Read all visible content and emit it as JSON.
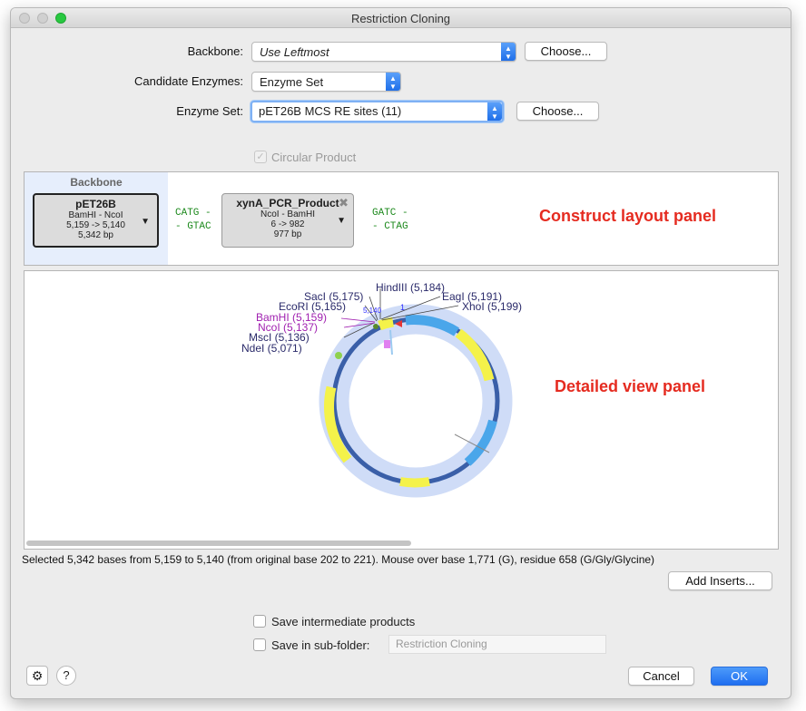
{
  "window": {
    "title": "Restriction Cloning"
  },
  "form": {
    "backbone_label": "Backbone:",
    "backbone_value": "Use Leftmost",
    "choose_label": "Choose...",
    "candidate_label": "Candidate Enzymes:",
    "candidate_value": "Enzyme Set",
    "enzyme_set_label": "Enzyme Set:",
    "enzyme_set_value": "pET26B MCS RE sites (11)",
    "circular_label": "Circular Product"
  },
  "construct": {
    "backbone_header": "Backbone",
    "backbone_fragment": {
      "name": "pET26B",
      "enzymes": "BamHI - NcoI",
      "range": "5,159 -> 5,140",
      "length": "5,342 bp"
    },
    "insert_fragment": {
      "name": "xynA_PCR_Product",
      "enzymes": "NcoI - BamHI",
      "range": "6 -> 982",
      "length": "977 bp"
    },
    "left_overhang": [
      "CATG -",
      "- GTAC"
    ],
    "right_overhang": [
      "GATC -",
      "- CTAG"
    ],
    "annotation": "Construct layout panel"
  },
  "detail": {
    "annotation": "Detailed view panel",
    "sites": [
      {
        "label": "HindIII (5,184)",
        "color": "#2a2a6a"
      },
      {
        "label": "EagI (5,191)",
        "color": "#2a2a6a"
      },
      {
        "label": "XhoI (5,199)",
        "color": "#2a2a6a"
      },
      {
        "label": "SacI (5,175)",
        "color": "#2a2a6a"
      },
      {
        "label": "EcoRI (5,165)",
        "color": "#2a2a6a"
      },
      {
        "label": "BamHI (5,159)",
        "color": "#a020b0"
      },
      {
        "label": "NcoI (5,137)",
        "color": "#a020b0"
      },
      {
        "label": "MscI (5,136)",
        "color": "#2a2a6a"
      },
      {
        "label": "NdeI (5,071)",
        "color": "#2a2a6a"
      }
    ],
    "small_labels": {
      "left": "5,140",
      "right": "1"
    }
  },
  "status": "Selected 5,342 bases from 5,159 to 5,140 (from original base 202 to 221). Mouse over base 1,771 (G), residue 658 (G/Gly/Glycine)",
  "buttons": {
    "add_inserts": "Add Inserts...",
    "cancel": "Cancel",
    "ok": "OK"
  },
  "options": {
    "save_intermediate": "Save intermediate products",
    "save_subfolder": "Save in sub-folder:",
    "subfolder_value": "Restriction Cloning"
  },
  "icons": {
    "gear": "gear-icon",
    "help": "help-icon"
  },
  "colors": {
    "accent": "#1f6ef0",
    "annotation": "#e52b20",
    "backbone_ring": "#3a5fa8",
    "halo": "#cfdcf7",
    "feature_yellow": "#f4f24a",
    "feature_blue": "#4aa6ea"
  }
}
